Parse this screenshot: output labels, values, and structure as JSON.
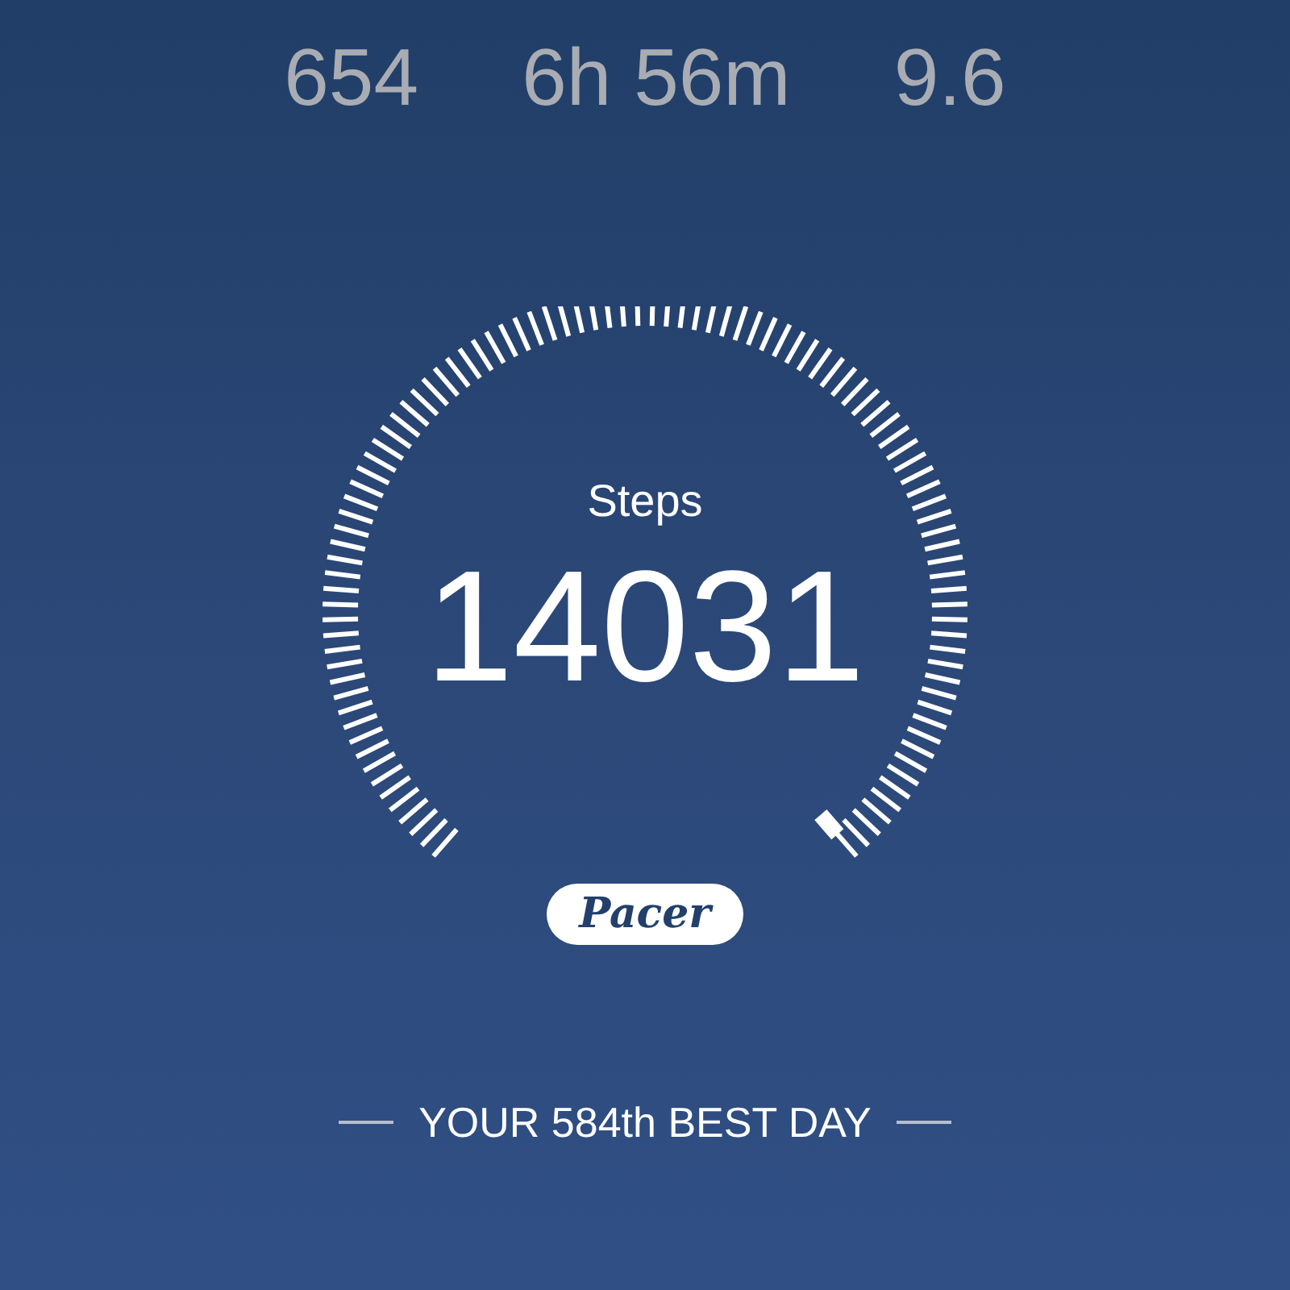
{
  "stats": [
    {
      "value": "654"
    },
    {
      "value": "6h 56m"
    },
    {
      "value": "9.6"
    }
  ],
  "gauge": {
    "label": "Steps",
    "value": "14031",
    "logo": "Pacer"
  },
  "rank": "YOUR 584th BEST DAY"
}
